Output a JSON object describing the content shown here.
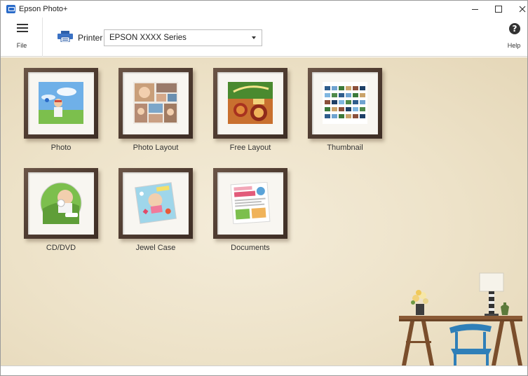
{
  "window": {
    "title": "Epson Photo+"
  },
  "toolbar": {
    "file_label": "File",
    "printer_label": "Printer",
    "printer_value": "EPSON XXXX Series",
    "help_label": "Help"
  },
  "tiles": [
    {
      "label": "Photo",
      "icon": "photo-icon"
    },
    {
      "label": "Photo Layout",
      "icon": "photo-layout-icon"
    },
    {
      "label": "Free Layout",
      "icon": "free-layout-icon"
    },
    {
      "label": "Thumbnail",
      "icon": "thumbnail-icon"
    },
    {
      "label": "CD/DVD",
      "icon": "cd-dvd-icon"
    },
    {
      "label": "Jewel Case",
      "icon": "jewel-case-icon"
    },
    {
      "label": "Documents",
      "icon": "documents-icon"
    }
  ],
  "colors": {
    "frame": "#4e3b30",
    "background": "#ede2c8",
    "accent": "#2a6bc9"
  }
}
